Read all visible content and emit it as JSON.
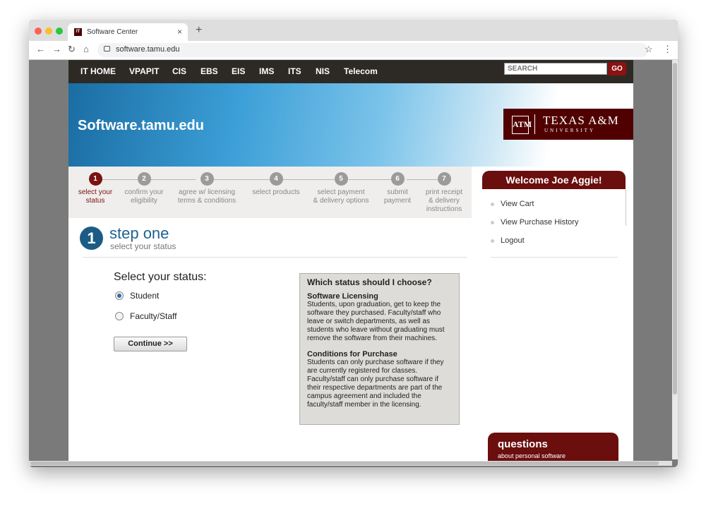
{
  "browser": {
    "tab_title": "Software Center",
    "tab_favicon_text": "IT",
    "url": "software.tamu.edu",
    "close_glyph": "×",
    "newtab_glyph": "+",
    "back_glyph": "←",
    "forward_glyph": "→",
    "reload_glyph": "↻",
    "home_glyph": "⌂",
    "star_glyph": "☆",
    "menu_glyph": "⋮"
  },
  "topnav": {
    "links": [
      "IT HOME",
      "VPAPIT",
      "CIS",
      "EBS",
      "EIS",
      "IMS",
      "ITS",
      "NIS",
      "Telecom"
    ],
    "search_placeholder": "SEARCH",
    "search_button": "GO"
  },
  "banner": {
    "site_title": "Software.tamu.edu",
    "logo_mark": "ATM",
    "logo_line1": "TEXAS A&M",
    "logo_line2": "UNIVERSITY"
  },
  "steps": [
    {
      "number": "1",
      "label_line1": "select your",
      "label_line2": "status",
      "label_line3": "",
      "active": true
    },
    {
      "number": "2",
      "label_line1": "confirm your",
      "label_line2": "eligibility",
      "label_line3": "",
      "active": false
    },
    {
      "number": "3",
      "label_line1": "agree w/ licensing",
      "label_line2": "terms & conditions",
      "label_line3": "",
      "active": false
    },
    {
      "number": "4",
      "label_line1": "select products",
      "label_line2": "",
      "label_line3": "",
      "active": false
    },
    {
      "number": "5",
      "label_line1": "select payment",
      "label_line2": "& delivery options",
      "label_line3": "",
      "active": false
    },
    {
      "number": "6",
      "label_line1": "submit",
      "label_line2": "payment",
      "label_line3": "",
      "active": false
    },
    {
      "number": "7",
      "label_line1": "print receipt",
      "label_line2": "& delivery",
      "label_line3": "instructions",
      "active": false
    }
  ],
  "main": {
    "step_number": "1",
    "step_title": "step one",
    "step_subtitle": "select your status",
    "status_heading": "Select your status:",
    "options": [
      {
        "label": "Student",
        "selected": true
      },
      {
        "label": "Faculty/Staff",
        "selected": false
      }
    ],
    "continue_button": "Continue >>"
  },
  "info_box": {
    "heading": "Which status should I choose?",
    "sections": [
      {
        "title": "Software Licensing",
        "text": "Students, upon graduation, get to keep the software they purchased. Faculty/staff who leave or switch departments, as well as students who leave without graduating must remove the software from their machines."
      },
      {
        "title": "Conditions for Purchase",
        "text": "Students can only purchase software if they are currently registered for classes. Faculty/staff can only purchase software if their respective departments are part of the campus agreement and included the faculty/staff member in the licensing."
      }
    ]
  },
  "sidebar": {
    "welcome": "Welcome Joe Aggie!",
    "items": [
      "View Cart",
      "View Purchase History",
      "Logout"
    ],
    "questions_heading": "questions",
    "questions_sub": "about personal software"
  },
  "colors": {
    "maroon": "#500000",
    "nav_dark": "#2d2a26",
    "step_active": "#7a1212",
    "step_blue": "#1c5b84"
  }
}
